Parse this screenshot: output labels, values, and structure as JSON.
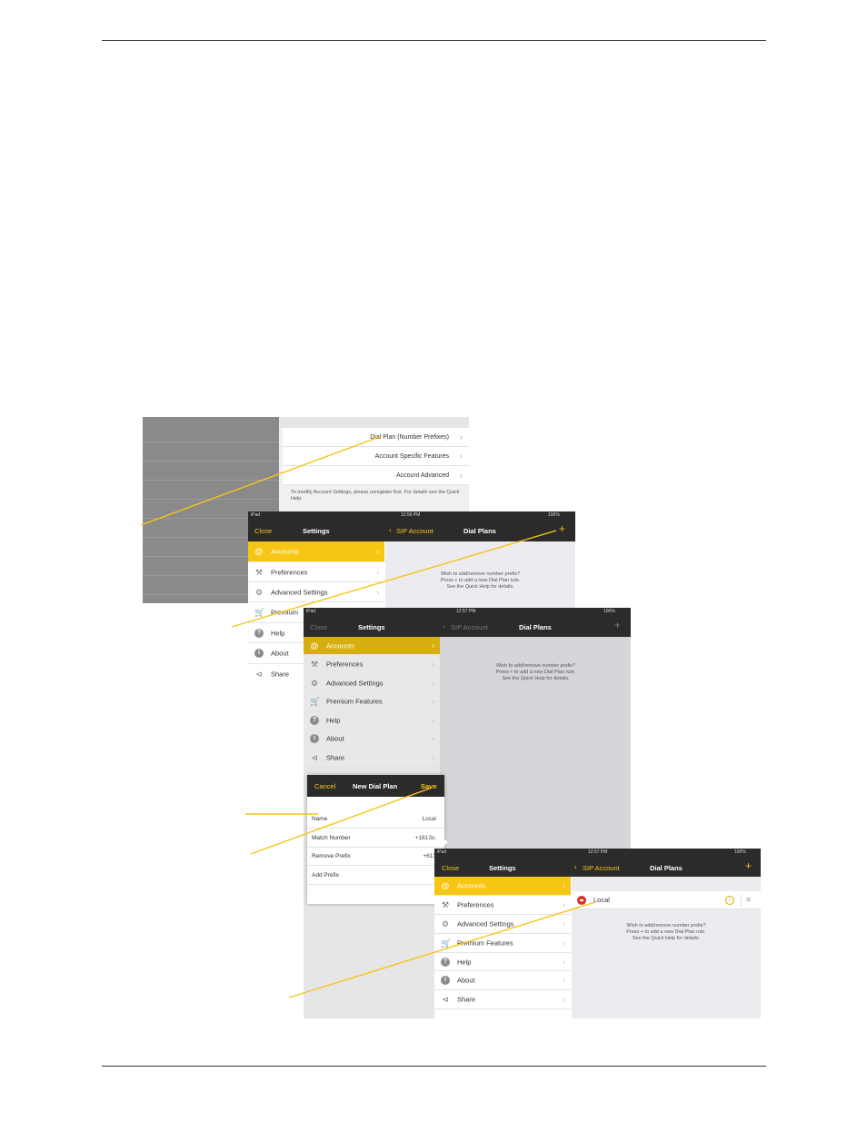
{
  "page": {
    "top_rule": true,
    "bottom_rule": true
  },
  "shot1": {
    "rows": [
      "Dial Plan (Number Prefixes)",
      "Account Specific Features",
      "Account Advanced"
    ],
    "note": "To modify Account Settings, please unregister first.  For details see the Quick Help."
  },
  "shot2": {
    "status": {
      "left": "iPad",
      "time": "12:56 PM",
      "battery": "100%"
    },
    "nav": {
      "close": "Close",
      "title": "Settings",
      "back": "SIP Account",
      "detail_title": "Dial Plans",
      "add": "+"
    },
    "menu": [
      "Accounts",
      "Preferences",
      "Advanced Settings",
      "Premium",
      "Help",
      "About",
      "Share"
    ],
    "hint": [
      "Wish to add/remove number prefix?",
      "Press + to add a new Dial Plan rule.",
      "See the Quick Help for details."
    ]
  },
  "shot3": {
    "status": {
      "left": "iPad",
      "time": "12:57 PM",
      "battery": "100%"
    },
    "nav": {
      "close": "Close",
      "title": "Settings",
      "back": "SIP Account",
      "detail_title": "Dial Plans",
      "add": "+"
    },
    "menu": [
      "Accounts",
      "Preferences",
      "Advanced Settings",
      "Premium Features",
      "Help",
      "About",
      "Share"
    ],
    "hint": [
      "Wish to add/remove number prefix?",
      "Press + to add a new Dial Plan rule.",
      "See the Quick Help for details."
    ]
  },
  "dialog": {
    "cancel": "Cancel",
    "title": "New Dial Plan",
    "save": "Save",
    "fields": [
      {
        "label": "Name",
        "value": "Local"
      },
      {
        "label": "Match Number",
        "value": "+1613x."
      },
      {
        "label": "Remove Prefix",
        "value": "+613"
      },
      {
        "label": "Add Prefix",
        "value": ""
      }
    ]
  },
  "shot4": {
    "status": {
      "left": "iPad",
      "time": "12:57 PM",
      "battery": "100%"
    },
    "nav": {
      "close": "Close",
      "title": "Settings",
      "back": "SIP Account",
      "detail_title": "Dial Plans",
      "add": "+"
    },
    "menu": [
      "Accounts",
      "Preferences",
      "Advanced Settings",
      "Premium Features",
      "Help",
      "About",
      "Share"
    ],
    "local": "Local",
    "hint": [
      "Wish to add/remove number prefix?",
      "Press + to add a new Dial Plan rule.",
      "See the Quick Help for details."
    ]
  },
  "colors": {
    "accent": "#f7c614",
    "callout": "#f5c518",
    "navbar": "#2b2b2b",
    "delete": "#d9302c"
  },
  "icons": [
    "at-icon",
    "wrench-icon",
    "gears-icon",
    "cart-icon",
    "help-icon",
    "info-icon",
    "share-icon",
    "chevron-right-icon",
    "plus-icon",
    "back-chevron-icon",
    "info-circle-icon",
    "reorder-icon",
    "delete-icon"
  ]
}
